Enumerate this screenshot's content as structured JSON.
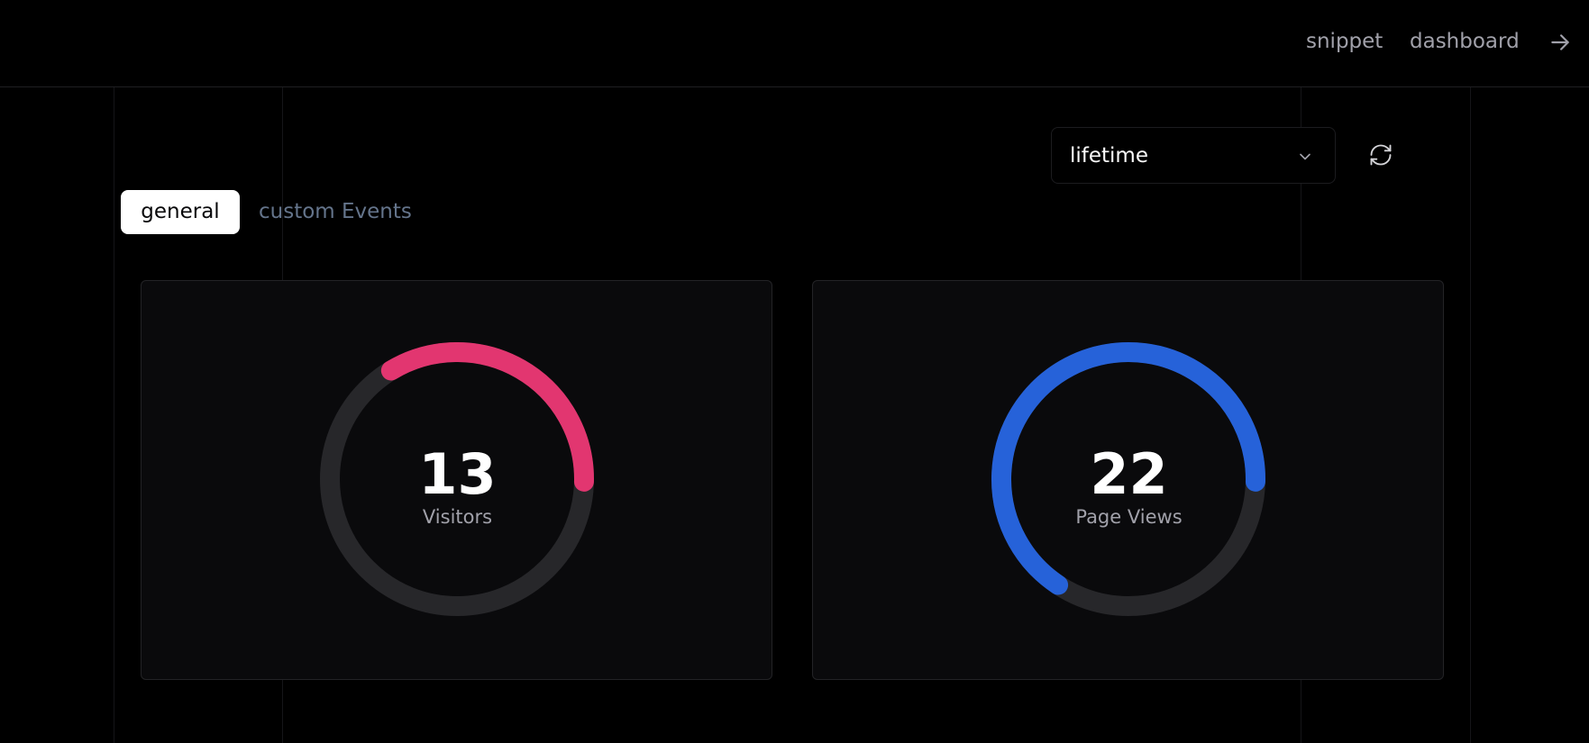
{
  "nav": {
    "snippet_label": "snippet",
    "dashboard_label": "dashboard",
    "arrow_icon": "arrow-right-icon"
  },
  "controls": {
    "period_selected": "lifetime",
    "chevron_icon": "chevron-down-icon",
    "refresh_icon": "refresh-icon"
  },
  "tabs": [
    {
      "label": "general",
      "active": true
    },
    {
      "label": "custom Events",
      "active": false
    }
  ],
  "metrics": [
    {
      "value": "13",
      "label": "Visitors",
      "color": "#e23670",
      "gauge_fraction": 0.34
    },
    {
      "value": "22",
      "label": "Page Views",
      "color": "#2662d9",
      "gauge_fraction": 0.66
    }
  ],
  "colors": {
    "background": "#000000",
    "card": "#0a0a0c",
    "track": "#27272a",
    "muted": "#a1a1aa",
    "tab_inactive": "#64748b"
  }
}
